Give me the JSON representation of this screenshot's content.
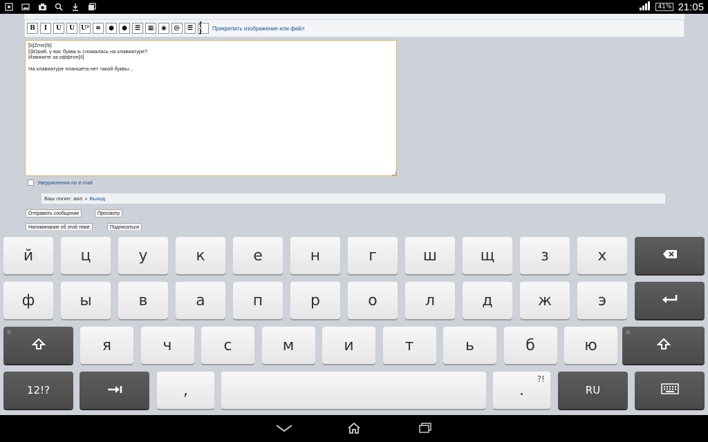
{
  "status_bar": {
    "left_icons": [
      "notification-icon",
      "image-icon",
      "camera-icon",
      "search-icon",
      "download-icon",
      "gallery-icon"
    ],
    "signal": "signal-icon",
    "battery": "41%",
    "time": "21:05"
  },
  "editor": {
    "toolbar_buttons": [
      {
        "name": "bold-button",
        "label": "B"
      },
      {
        "name": "italic-button",
        "label": "I"
      },
      {
        "name": "underline-button",
        "label": "U"
      },
      {
        "name": "strikethrough-button",
        "label": "U"
      },
      {
        "name": "superscript-button",
        "label": "U²"
      },
      {
        "name": "align-button",
        "label": "≡"
      },
      {
        "name": "color-button",
        "label": "●"
      },
      {
        "name": "color2-button",
        "label": "●"
      },
      {
        "name": "list-button",
        "label": "☰"
      },
      {
        "name": "table-button",
        "label": "▦"
      },
      {
        "name": "globe-button",
        "label": "◉"
      },
      {
        "name": "email-button",
        "label": "@"
      },
      {
        "name": "bullets-button",
        "label": "☰"
      },
      {
        "name": "code-button",
        "label": "{ }"
      }
    ],
    "attach_link": "Прикрепить изображение или файл",
    "text": "[b]Zme[/b]\n[i]Юрий, у вас буква Ь сломалась на клавиатуре?\nИзвините за оффтоп[/i]\n\nНа клавиатуре планшета нет такой буквы...",
    "notify_label": "Уведомления по e-mail",
    "login_prefix": "Ваш логин: ",
    "login_user": "aws",
    "login_separator": " » ",
    "logout_link": "Выход",
    "buttons": {
      "send": "Отправить сообщение",
      "preview": "Просмотр",
      "remind": "Напоминание об этой теме",
      "subscribe": "Подписаться"
    }
  },
  "keyboard": {
    "row1": [
      "й",
      "ц",
      "у",
      "к",
      "е",
      "н",
      "г",
      "ш",
      "щ",
      "з",
      "х"
    ],
    "row2": [
      "ф",
      "ы",
      "в",
      "а",
      "п",
      "р",
      "о",
      "л",
      "д",
      "ж",
      "э"
    ],
    "row3": [
      "я",
      "ч",
      "с",
      "м",
      "и",
      "т",
      "ь",
      "б",
      "ю"
    ],
    "numbers_key": "12!?",
    "comma_key": ",",
    "period_key": ".",
    "period_alt": "?!",
    "language_key": "RU",
    "backspace_icon": "backspace-icon",
    "enter_icon": "enter-icon",
    "shift_icon": "shift-icon",
    "tab_icon": "tab-icon",
    "hide_keyboard_icon": "keyboard-icon"
  },
  "nav_bar": {
    "back_icon": "back-icon",
    "home_icon": "home-icon",
    "recents_icon": "recents-icon"
  }
}
